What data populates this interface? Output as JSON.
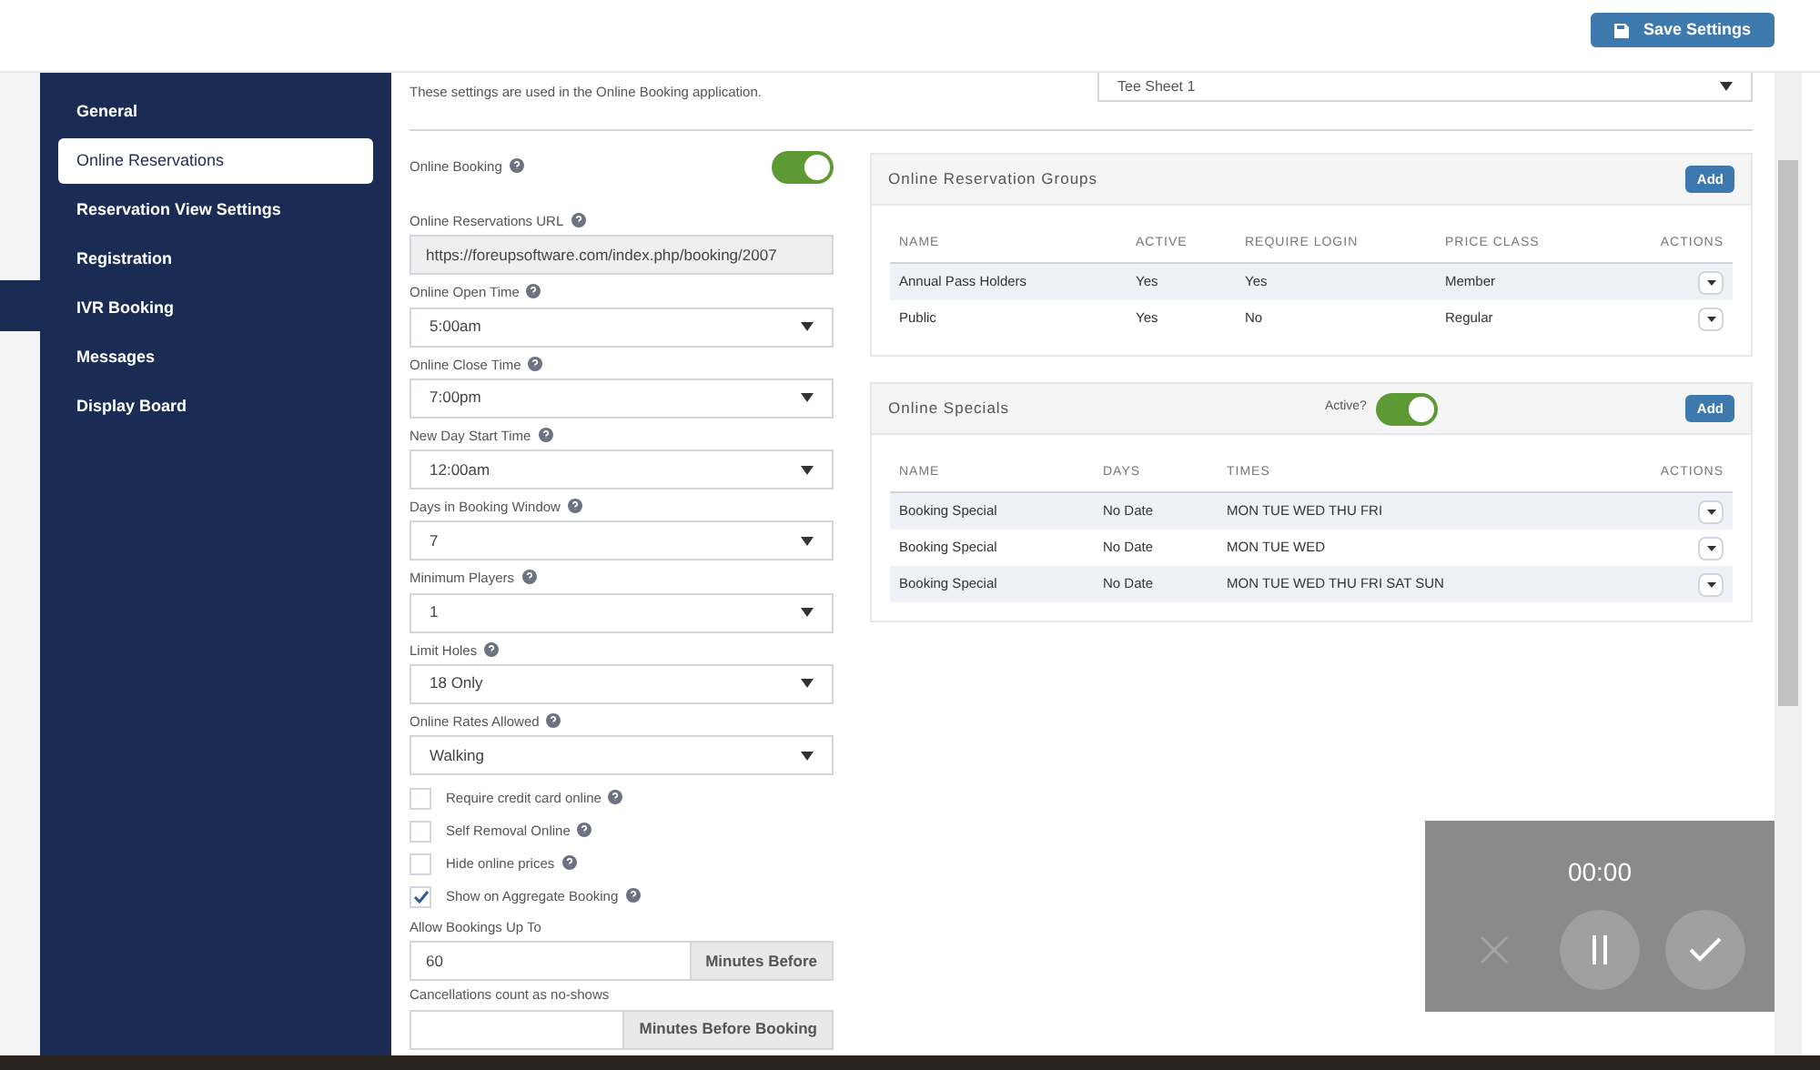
{
  "header": {
    "save_button": "Save Settings"
  },
  "sidebar": {
    "items": [
      {
        "label": "General",
        "selected": false
      },
      {
        "label": "Online Reservations",
        "selected": true
      },
      {
        "label": "Reservation View Settings",
        "selected": false
      },
      {
        "label": "Registration",
        "selected": false
      },
      {
        "label": "IVR Booking",
        "selected": false
      },
      {
        "label": "Messages",
        "selected": false
      },
      {
        "label": "Display Board",
        "selected": false
      }
    ]
  },
  "intro": "These settings are used in the Online Booking application.",
  "tee_sheet_select": "Tee Sheet 1",
  "online_booking": {
    "label": "Online Booking",
    "on": true
  },
  "url_field": {
    "label": "Online Reservations URL",
    "value": "https://foreupsoftware.com/index.php/booking/2007"
  },
  "selects": [
    {
      "label": "Online Open Time",
      "value": "5:00am"
    },
    {
      "label": "Online Close Time",
      "value": "7:00pm"
    },
    {
      "label": "New Day Start Time",
      "value": "12:00am"
    },
    {
      "label": "Days in Booking Window",
      "value": "7"
    },
    {
      "label": "Minimum Players",
      "value": "1"
    },
    {
      "label": "Limit Holes",
      "value": "18 Only"
    },
    {
      "label": "Online Rates Allowed",
      "value": "Walking"
    }
  ],
  "checkboxes": [
    {
      "label": "Require credit card online",
      "checked": false
    },
    {
      "label": "Self Removal Online",
      "checked": false
    },
    {
      "label": "Hide online prices",
      "checked": false
    },
    {
      "label": "Show on Aggregate Booking",
      "checked": true
    }
  ],
  "addon_fields": [
    {
      "label": "Allow Bookings Up To",
      "value": "60",
      "addon": "Minutes Before"
    },
    {
      "label": "Cancellations count as no-shows",
      "addon": "Minutes Before Booking"
    }
  ],
  "groups_panel": {
    "title": "Online Reservation Groups",
    "add_button": "Add",
    "columns": [
      "NAME",
      "ACTIVE",
      "REQUIRE LOGIN",
      "PRICE CLASS",
      "ACTIONS"
    ],
    "rows": [
      [
        "Annual Pass Holders",
        "Yes",
        "Yes",
        "Member"
      ],
      [
        "Public",
        "Yes",
        "No",
        "Regular"
      ]
    ]
  },
  "specials_panel": {
    "title": "Online Specials",
    "active_label": "Active?",
    "active_on": true,
    "add_button": "Add",
    "columns": [
      "NAME",
      "DAYS",
      "TIMES",
      "ACTIONS"
    ],
    "rows": [
      [
        "Booking Special",
        "No Date",
        "MON TUE WED THU FRI"
      ],
      [
        "Booking Special",
        "No Date",
        "MON TUE WED"
      ],
      [
        "Booking Special",
        "No Date",
        "MON TUE WED THU FRI SAT SUN"
      ]
    ]
  },
  "recorder": {
    "time": "00:00"
  }
}
